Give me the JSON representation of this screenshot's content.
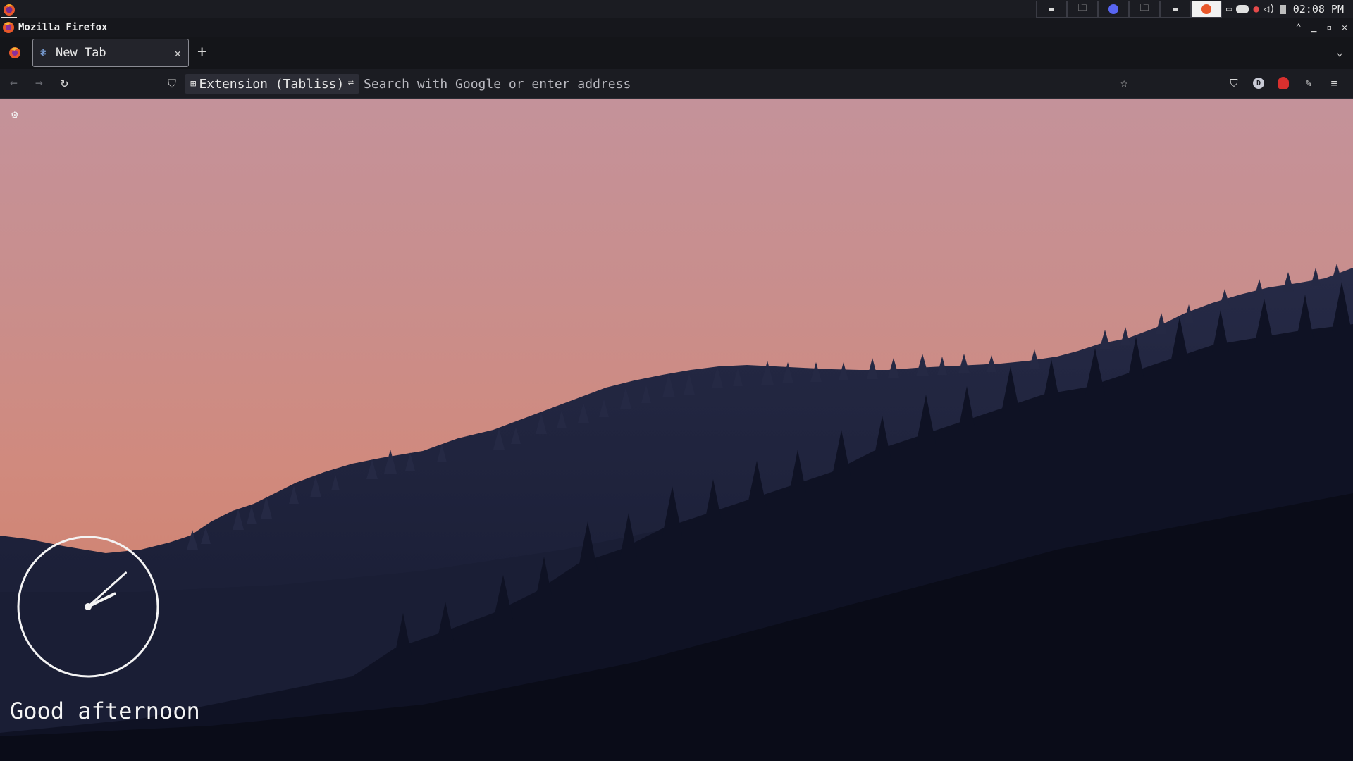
{
  "system_bar": {
    "task_buttons": [
      {
        "name": "workspace-1",
        "glyph": "▬"
      },
      {
        "name": "workspace-2",
        "glyph": "🗀"
      },
      {
        "name": "discord-task",
        "glyph": "◉"
      },
      {
        "name": "workspace-4",
        "glyph": "🗀"
      },
      {
        "name": "workspace-5",
        "glyph": "▬"
      },
      {
        "name": "firefox-task",
        "glyph": "●"
      }
    ],
    "clock": "02:08 PM"
  },
  "window": {
    "title": "Mozilla Firefox",
    "controls": {
      "minimize": "▁",
      "up": "⌃",
      "maximize": "▫",
      "close": "✕"
    }
  },
  "tabs": {
    "items": [
      {
        "label": "New Tab",
        "close": "✕"
      }
    ],
    "new_tab": "+",
    "list_all": "⌄"
  },
  "navbar": {
    "back": "←",
    "forward": "→",
    "reload": "↻",
    "identity_label": "Extension (Tabliss)",
    "url_placeholder": "Search with Google or enter address",
    "bookmark": "☆",
    "menu": "≡"
  },
  "newtab_page": {
    "greeting": "Good afternoon",
    "clock": {
      "hour": 2,
      "minute": 8
    }
  },
  "colors": {
    "sky_top": "#c4929a",
    "sky_bottom": "#d08472",
    "far_hills": "#20243d",
    "near_forest": "#0d0f1c",
    "accent_red": "#d8302e"
  }
}
